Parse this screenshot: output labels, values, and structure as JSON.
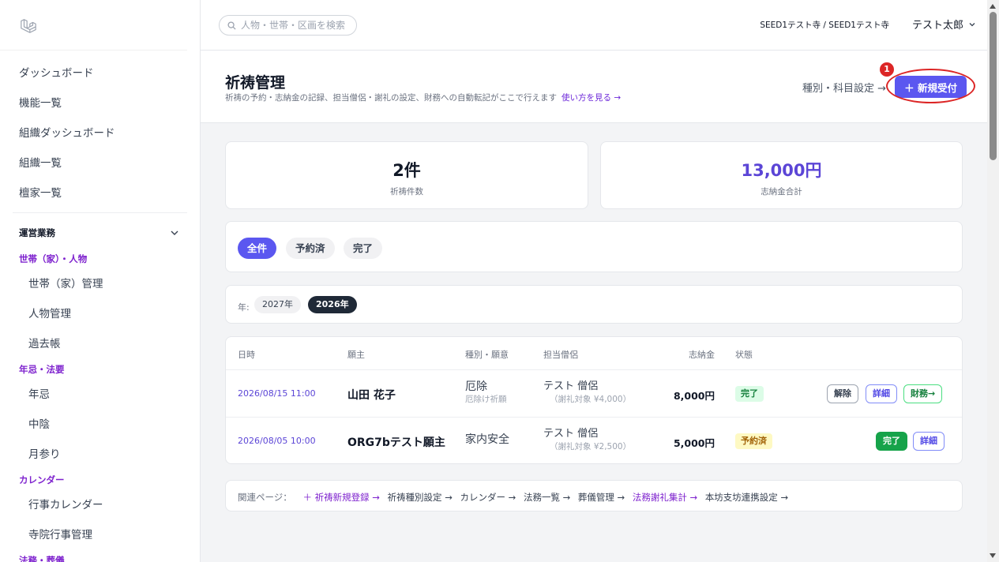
{
  "sidebar": {
    "logo_icon": "laravel-logo-icon",
    "top_items": [
      {
        "label": "ダッシュボード"
      },
      {
        "label": "機能一覧"
      },
      {
        "label": "組織ダッシュボード"
      },
      {
        "label": "組織一覧"
      },
      {
        "label": "檀家一覧"
      }
    ],
    "section": {
      "label": "運営業務",
      "icon": "chevron-down-icon"
    },
    "groups": [
      {
        "label": "世帯（家）・人物",
        "items": [
          {
            "label": "世帯（家）管理"
          },
          {
            "label": "人物管理"
          },
          {
            "label": "過去帳"
          }
        ]
      },
      {
        "label": "年忌・法要",
        "items": [
          {
            "label": "年忌"
          },
          {
            "label": "中陰"
          },
          {
            "label": "月参り"
          }
        ]
      },
      {
        "label": "カレンダー",
        "items": [
          {
            "label": "行事カレンダー"
          },
          {
            "label": "寺院行事管理"
          }
        ]
      },
      {
        "label": "法務・葬儀",
        "items": []
      }
    ]
  },
  "topbar": {
    "search_placeholder": "人物・世帯・区画を検索",
    "tenant": "SEED1テスト寺 / SEED1テスト寺",
    "user_name": "テスト太郎",
    "colors": {
      "accent": "#5b57f0",
      "annotation": "#dc2626"
    }
  },
  "header": {
    "title": "祈祷管理",
    "subtitle": "祈祷の予約・志納金の記録、担当僧侶・謝礼の設定、財務への自動転記がここで行えます",
    "howto_link": "使い方を見る →",
    "type_settings_link": "種別・科目設定 →",
    "new_button": "＋ 新規受付",
    "annotation_number": "1"
  },
  "stats": [
    {
      "value": "2件",
      "label": "祈祷件数"
    },
    {
      "value": "13,000円",
      "label": "志納金合計"
    }
  ],
  "status_filters": [
    {
      "label": "全件",
      "active": true
    },
    {
      "label": "予約済",
      "active": false
    },
    {
      "label": "完了",
      "active": false
    }
  ],
  "year_filter": {
    "label": "年:",
    "years": [
      {
        "label": "2027年",
        "active": false
      },
      {
        "label": "2026年",
        "active": true
      }
    ]
  },
  "table": {
    "headers": [
      "日時",
      "願主",
      "種別・願意",
      "担当僧侶",
      "志納金",
      "状態"
    ],
    "rows": [
      {
        "datetime": "2026/08/15 11:00",
        "patron": "山田 花子",
        "kind": "厄除",
        "kind_sub": "厄除け祈願",
        "priest": "テスト 僧侶",
        "priest_sub": "（謝礼対象 ¥4,000）",
        "amount": "8,000円",
        "status": "完了",
        "actions": [
          "解除",
          "詳細",
          "財務→"
        ]
      },
      {
        "datetime": "2026/08/05 10:00",
        "patron": "ORG7bテスト願主",
        "kind": "家内安全",
        "kind_sub": "",
        "priest": "テスト 僧侶",
        "priest_sub": "（謝礼対象 ¥2,500）",
        "amount": "5,000円",
        "status": "予約済",
        "actions": [
          "完了",
          "詳細"
        ]
      }
    ]
  },
  "related": {
    "label": "関連ページ：",
    "links": [
      {
        "label": "＋ 祈祷新規登録 →",
        "highlight": true
      },
      {
        "label": "祈祷種別設定 →",
        "highlight": false
      },
      {
        "label": "カレンダー →",
        "highlight": false
      },
      {
        "label": "法務一覧 →",
        "highlight": false
      },
      {
        "label": "葬儀管理 →",
        "highlight": false
      },
      {
        "label": "法務謝礼集計 →",
        "highlight": true
      },
      {
        "label": "本坊支坊連携設定 →",
        "highlight": false
      }
    ]
  }
}
